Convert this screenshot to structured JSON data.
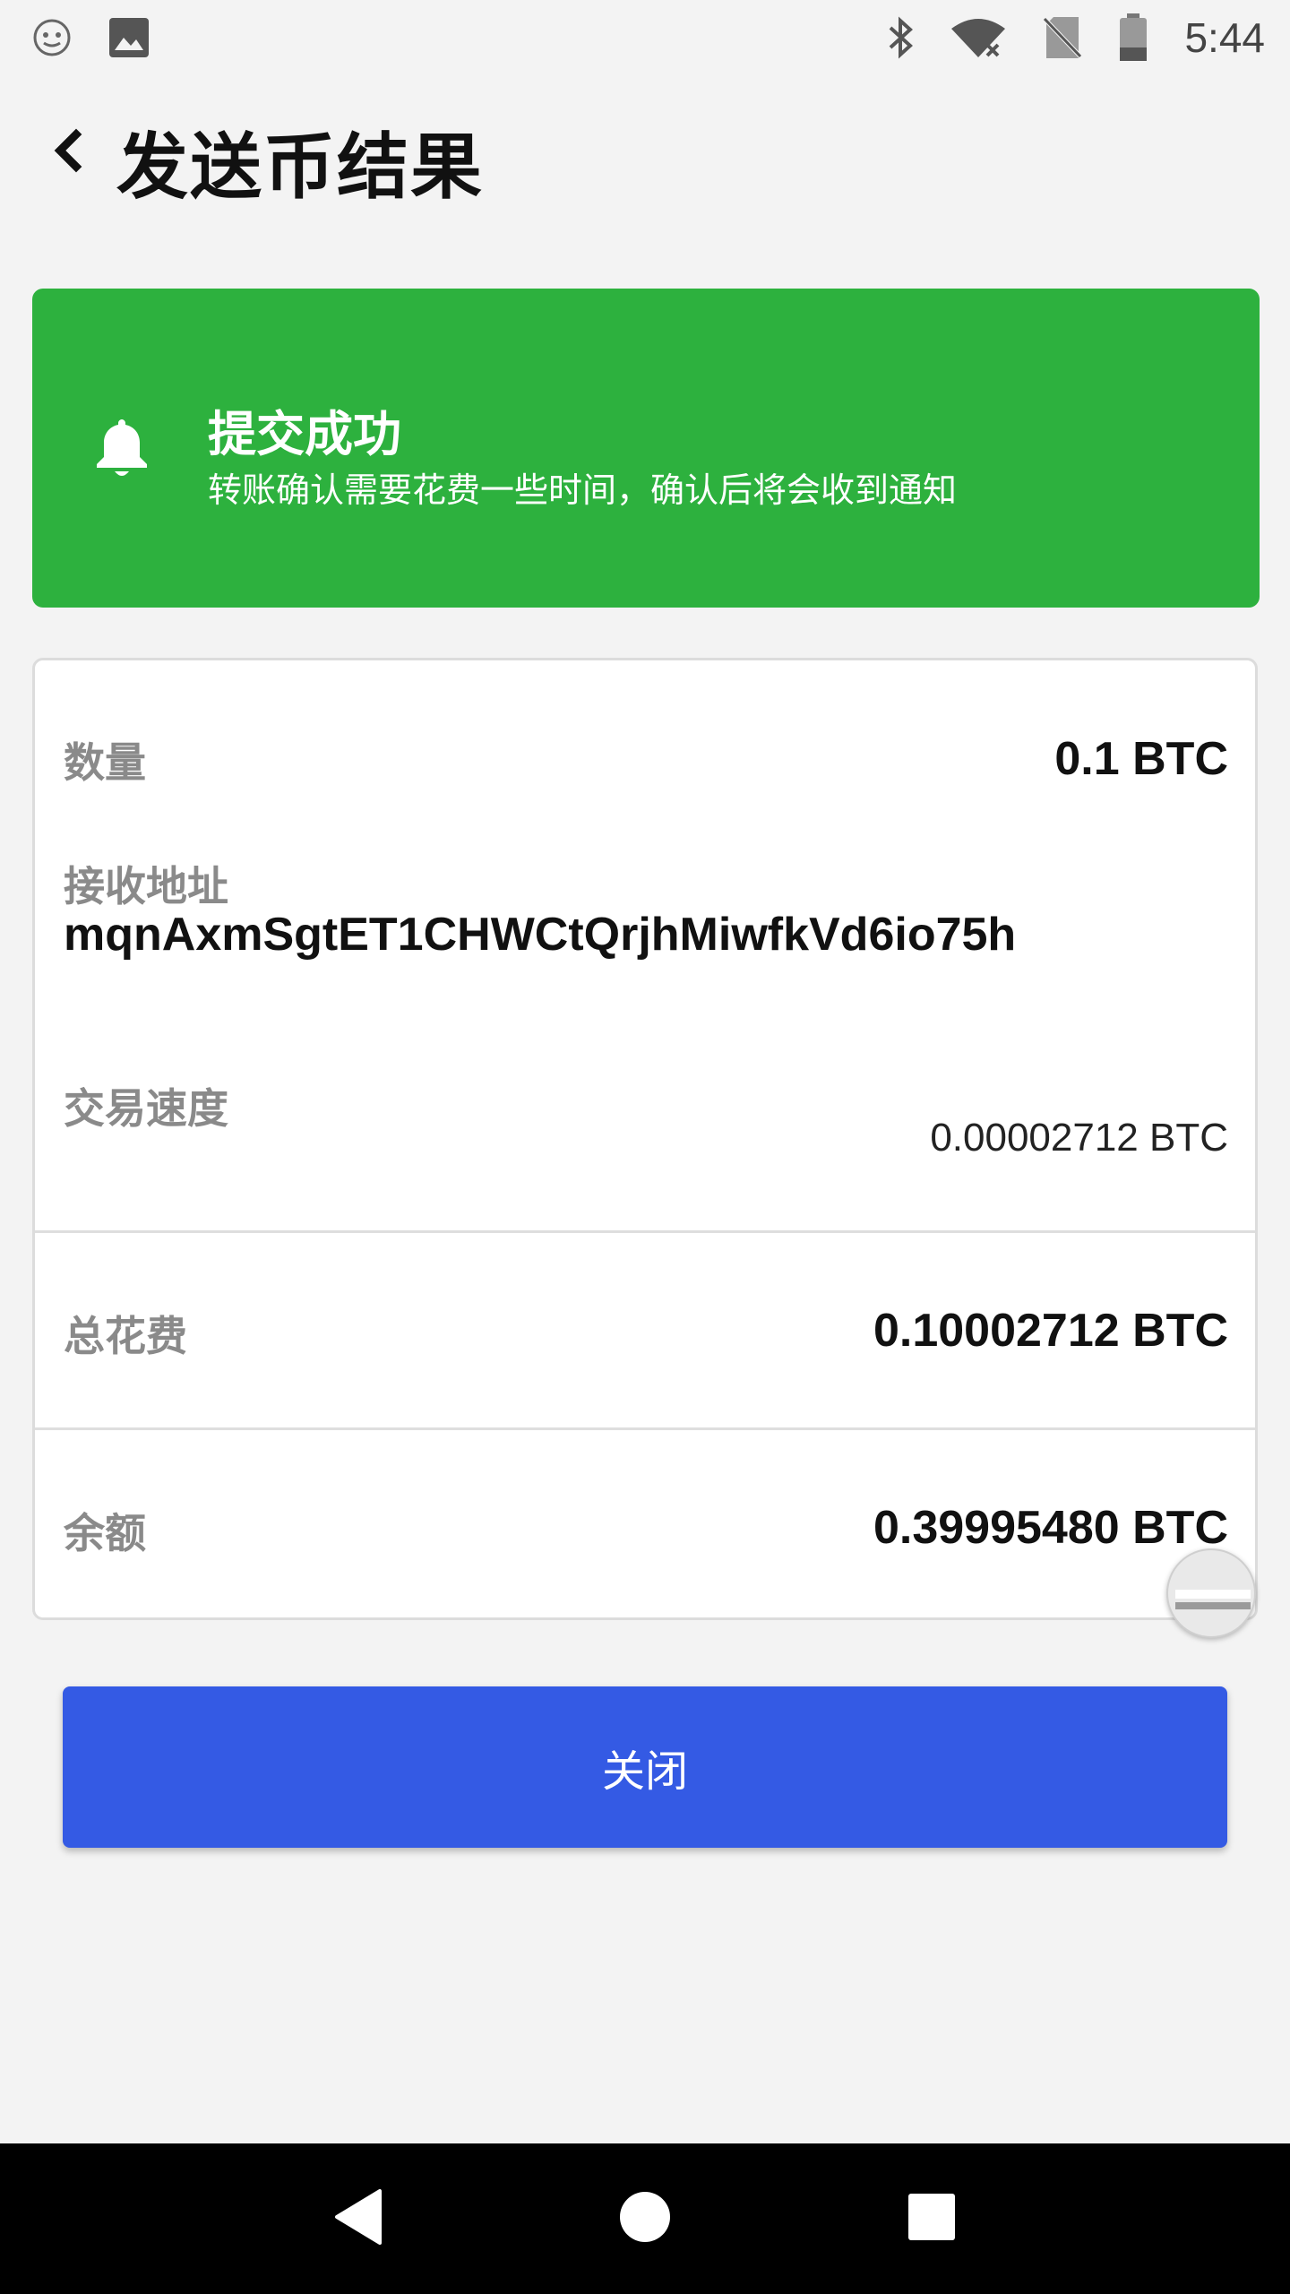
{
  "status_bar": {
    "time": "5:44",
    "icons": [
      "face-icon",
      "image-icon",
      "bluetooth-icon",
      "wifi-icon",
      "no-sim-icon",
      "battery-icon"
    ]
  },
  "header": {
    "title": "发送币结果",
    "back_icon": "chevron-left-icon"
  },
  "banner": {
    "icon": "bell-icon",
    "title": "提交成功",
    "subtitle": "转账确认需要花费一些时间，确认后将会收到通知",
    "color": "#2db13e"
  },
  "details": {
    "amount_label": "数量",
    "amount_value": "0.1 BTC",
    "address_label": "接收地址",
    "address_value": "mqnAxmSgtET1CHWCtQrjhMiwfkVd6io75h",
    "speed_label": "交易速度",
    "speed_value": "0.00002712 BTC",
    "total_label": "总花费",
    "total_value": "0.10002712 BTC",
    "balance_label": "余额",
    "balance_value": "0.39995480 BTC"
  },
  "close_button": {
    "label": "关闭",
    "color": "#345ae4"
  },
  "nav_bar": {
    "icons": [
      "back-triangle-icon",
      "home-circle-icon",
      "recents-square-icon"
    ]
  }
}
